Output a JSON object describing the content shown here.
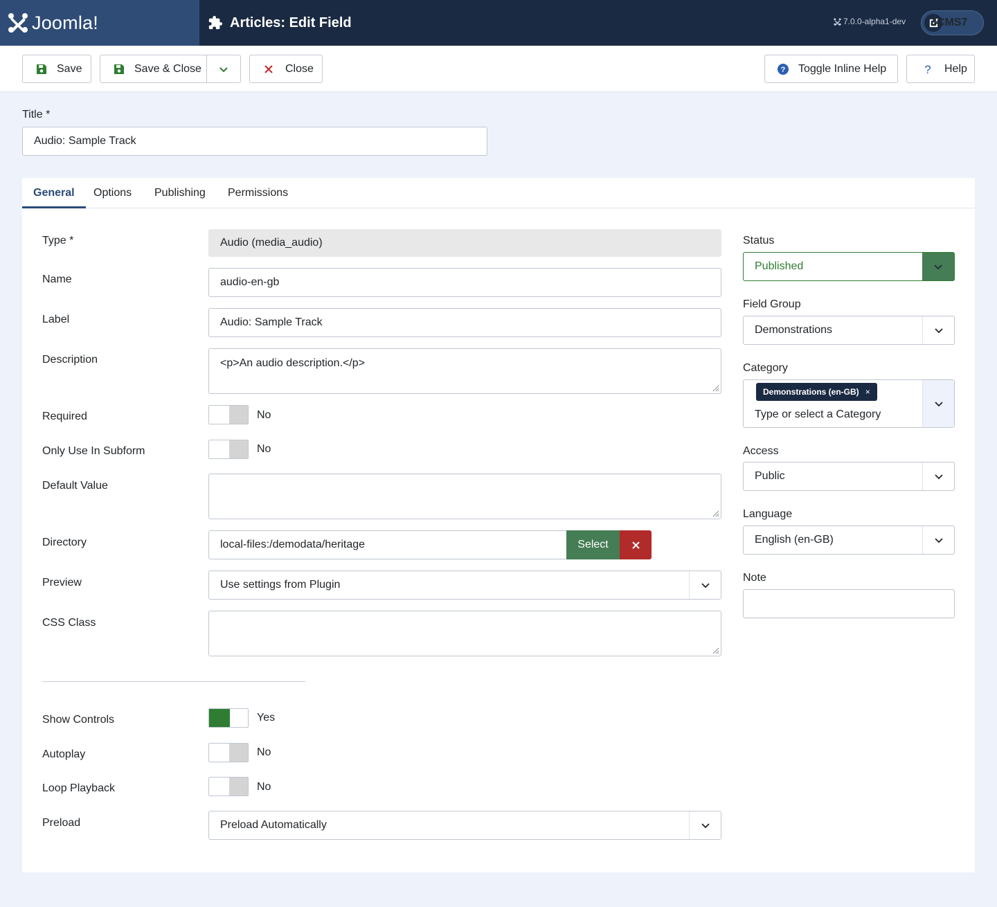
{
  "header": {
    "brand": "Joomla!",
    "page_title": "Articles: Edit Field",
    "version": "7.0.0-alpha1-dev",
    "site_button": "JCMS7"
  },
  "toolbar": {
    "save": "Save",
    "save_close": "Save & Close",
    "close": "Close",
    "toggle_help": "Toggle Inline Help",
    "help": "Help"
  },
  "title": {
    "label": "Title *",
    "value": "Audio: Sample Track"
  },
  "tabs": [
    "General",
    "Options",
    "Publishing",
    "Permissions"
  ],
  "general": {
    "type_label": "Type *",
    "type_value": "Audio (media_audio)",
    "name_label": "Name",
    "name_value": "audio-en-gb",
    "label_label": "Label",
    "label_value": "Audio: Sample Track",
    "description_label": "Description",
    "description_value": "<p>An audio description.</p>",
    "required_label": "Required",
    "required_value": "No",
    "subform_label": "Only Use In Subform",
    "subform_value": "No",
    "default_label": "Default Value",
    "default_value": "",
    "directory_label": "Directory",
    "directory_value": "local-files:/demodata/heritage",
    "select_button": "Select",
    "preview_label": "Preview",
    "preview_value": "Use settings from Plugin",
    "css_label": "CSS Class",
    "css_value": "",
    "show_controls_label": "Show Controls",
    "show_controls_value": "Yes",
    "autoplay_label": "Autoplay",
    "autoplay_value": "No",
    "loop_label": "Loop Playback",
    "loop_value": "No",
    "preload_label": "Preload",
    "preload_value": "Preload Automatically"
  },
  "sidebar": {
    "status_label": "Status",
    "status_value": "Published",
    "field_group_label": "Field Group",
    "field_group_value": "Demonstrations",
    "category_label": "Category",
    "category_chip": "Demonstrations (en-GB)",
    "category_chip_remove": "×",
    "category_placeholder": "Type or select a Category",
    "access_label": "Access",
    "access_value": "Public",
    "language_label": "Language",
    "language_value": "English (en-GB)",
    "note_label": "Note",
    "note_value": ""
  },
  "colors": {
    "header_bg": "#1b2a43",
    "brand_bg": "#2f4c76",
    "accent": "#2a4a78",
    "success": "#457d54",
    "danger": "#b12b2b"
  }
}
